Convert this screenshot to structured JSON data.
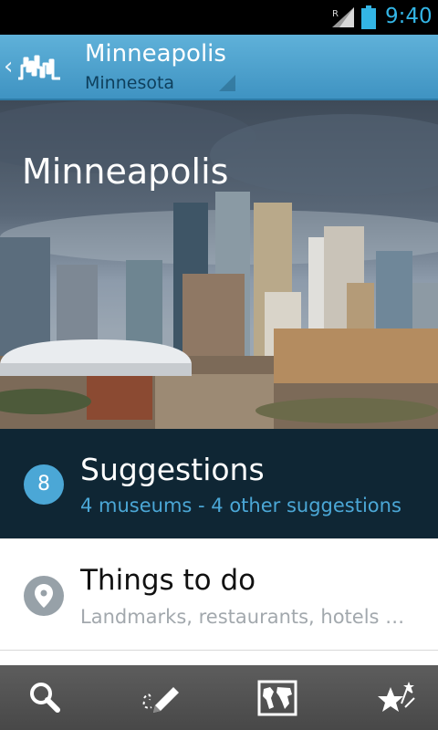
{
  "status_bar": {
    "time": "9:40",
    "roaming_indicator": "R",
    "icons": [
      "signal-icon",
      "battery-icon"
    ],
    "clock_color": "#33b5e5"
  },
  "action_bar": {
    "title": "Minneapolis",
    "subtitle": "Minnesota",
    "up_glyph": "‹",
    "logo_icon": "city-skyline-logo-icon",
    "background": "#4ea3cf"
  },
  "hero": {
    "title": "Minneapolis",
    "image": "minneapolis-skyline-photo"
  },
  "suggestions": {
    "count": "8",
    "title": "Suggestions",
    "subtitle": "4 museums - 4 other suggestions",
    "accent": "#4ba7d6"
  },
  "things_to_do": {
    "icon": "map-pin-icon",
    "title": "Things to do",
    "subtitle": "Landmarks, restaurants, hotels …"
  },
  "bottom_tabs": [
    {
      "name": "search",
      "icon": "search-icon"
    },
    {
      "name": "notes",
      "icon": "pencil-icon"
    },
    {
      "name": "map",
      "icon": "world-map-icon"
    },
    {
      "name": "favorites",
      "icon": "stars-icon"
    }
  ]
}
